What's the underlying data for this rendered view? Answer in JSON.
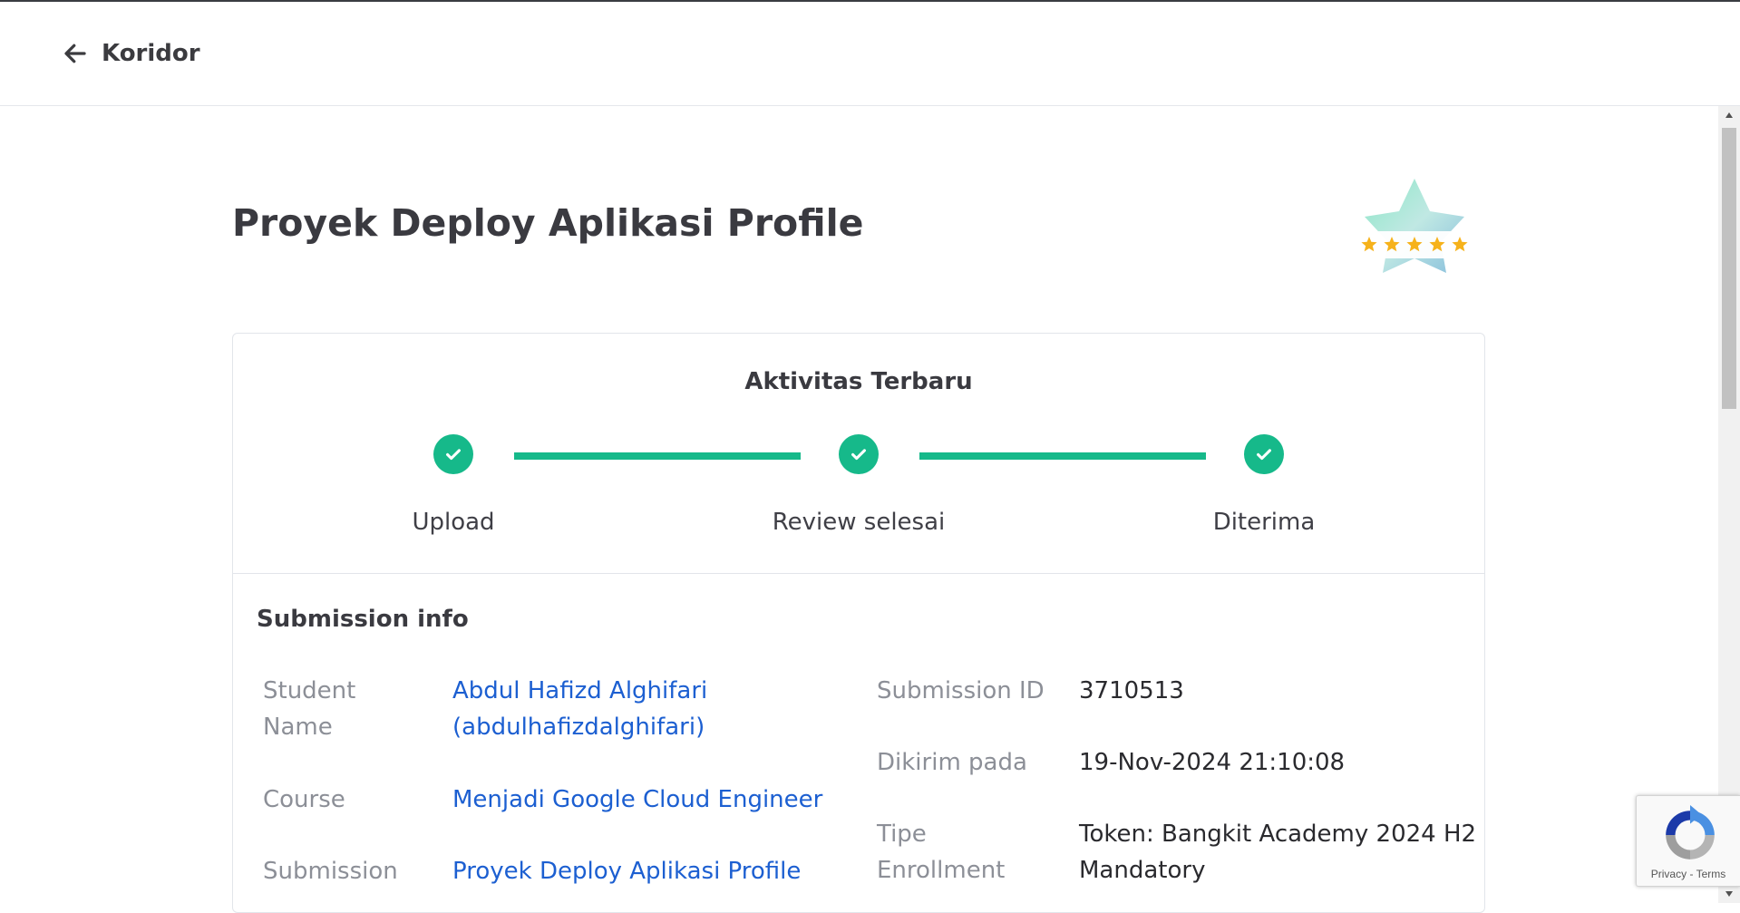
{
  "header": {
    "back_label": "Koridor"
  },
  "page": {
    "title": "Proyek Deploy Aplikasi Profile"
  },
  "rating": {
    "stars": 5,
    "max": 5
  },
  "activity": {
    "title": "Aktivitas Terbaru",
    "steps": [
      {
        "label": "Upload",
        "done": true
      },
      {
        "label": "Review selesai",
        "done": true
      },
      {
        "label": "Diterima",
        "done": true
      }
    ],
    "accent": "#16b98a"
  },
  "submission": {
    "title": "Submission info",
    "student_name_label_1": "Student",
    "student_name_label_2": "Name",
    "student_name": "Abdul Hafizd Alghifari",
    "student_username": "(abdulhafizdalghifari)",
    "course_label": "Course",
    "course": "Menjadi Google Cloud Engineer",
    "submission_label": "Submission",
    "submission": "Proyek Deploy Aplikasi Profile",
    "submission_id_label": "Submission ID",
    "submission_id": "3710513",
    "sent_label": "Dikirim pada",
    "sent_at": "19-Nov-2024 21:10:08",
    "enrollment_label_1": "Tipe",
    "enrollment_label_2": "Enrollment",
    "enrollment_1": "Token: Bangkit Academy 2024 H2",
    "enrollment_2": "Mandatory"
  },
  "recaptcha": {
    "privacy": "Privacy",
    "separator": " - ",
    "terms": "Terms"
  },
  "colors": {
    "link": "#1c5fd1",
    "label": "#8c8f97",
    "success": "#16b98a"
  }
}
